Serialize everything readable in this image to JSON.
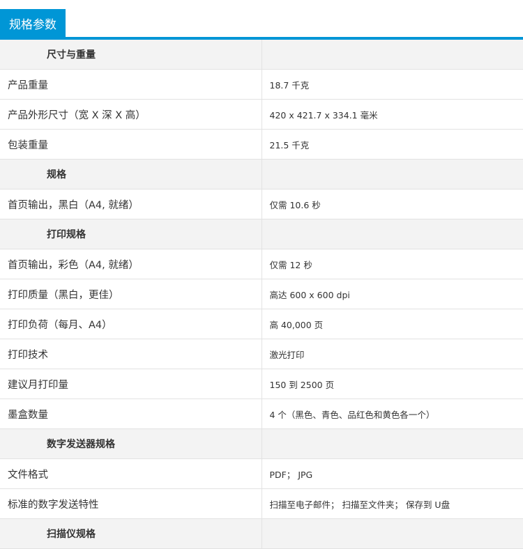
{
  "header": {
    "title": "规格参数"
  },
  "sections": [
    {
      "title": "尺寸与重量",
      "rows": [
        {
          "label": "产品重量",
          "value": "18.7 千克"
        },
        {
          "label": "产品外形尺寸（宽 X 深 X 高）",
          "value": "420 x 421.7 x 334.1 毫米"
        },
        {
          "label": "包装重量",
          "value": "21.5 千克"
        }
      ]
    },
    {
      "title": "规格",
      "rows": [
        {
          "label": "首页输出，黑白（A4, 就绪）",
          "value": "仅需 10.6 秒"
        }
      ]
    },
    {
      "title": "打印规格",
      "rows": [
        {
          "label": "首页输出，彩色（A4, 就绪）",
          "value": "仅需 12 秒"
        },
        {
          "label": "打印质量（黑白，更佳）",
          "value": "高达 600 x 600 dpi"
        },
        {
          "label": "打印负荷（每月、A4）",
          "value": "高 40,000 页"
        },
        {
          "label": "打印技术",
          "value": "激光打印"
        },
        {
          "label": "建议月打印量",
          "value": "150 到 2500 页"
        },
        {
          "label": "墨盒数量",
          "value": "4 个（黑色、青色、品红色和黄色各一个）"
        }
      ]
    },
    {
      "title": "数字发送器规格",
      "rows": [
        {
          "label": "文件格式",
          "value": "PDF； JPG"
        },
        {
          "label": "标准的数字发送特性",
          "value": "扫描至电子邮件； 扫描至文件夹； 保存到 U盘"
        }
      ]
    },
    {
      "title": "扫描仪规格",
      "rows": []
    }
  ]
}
